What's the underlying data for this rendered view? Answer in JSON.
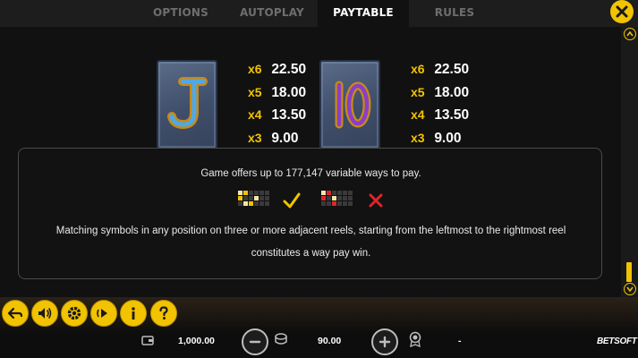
{
  "tabs": [
    {
      "label": "OPTIONS"
    },
    {
      "label": "AUTOPLAY"
    },
    {
      "label": "PAYTABLE"
    },
    {
      "label": "RULES"
    }
  ],
  "active_tab": "PAYTABLE",
  "paytable": {
    "symbols": [
      {
        "glyph": "J",
        "icon": "j-symbol-icon",
        "payouts": [
          {
            "mult": "x6",
            "value": "22.50"
          },
          {
            "mult": "x5",
            "value": "18.00"
          },
          {
            "mult": "x4",
            "value": "13.50"
          },
          {
            "mult": "x3",
            "value": "9.00"
          }
        ]
      },
      {
        "glyph": "10",
        "icon": "ten-symbol-icon",
        "payouts": [
          {
            "mult": "x6",
            "value": "22.50"
          },
          {
            "mult": "x5",
            "value": "18.00"
          },
          {
            "mult": "x4",
            "value": "13.50"
          },
          {
            "mult": "x3",
            "value": "9.00"
          }
        ]
      }
    ]
  },
  "ways": {
    "text": "Game offers up to 177,147 variable ways to pay.",
    "description_line1": "Matching symbols in any position on three or more adjacent reels, starting from the leftmost to the rightmost reel",
    "description_line2": "constitutes a way pay win.",
    "valid_icon": "check-icon",
    "invalid_icon": "x-cross-icon",
    "colors": {
      "valid": "#f2c300",
      "invalid": "#e0242b",
      "highlight": "#f5e6a8"
    }
  },
  "bottom": {
    "balance": "1,000.00",
    "bet": "90.00",
    "win": "-",
    "logo": "BETSOFT"
  },
  "colors": {
    "accent": "#f2c300",
    "background": "#111111"
  }
}
